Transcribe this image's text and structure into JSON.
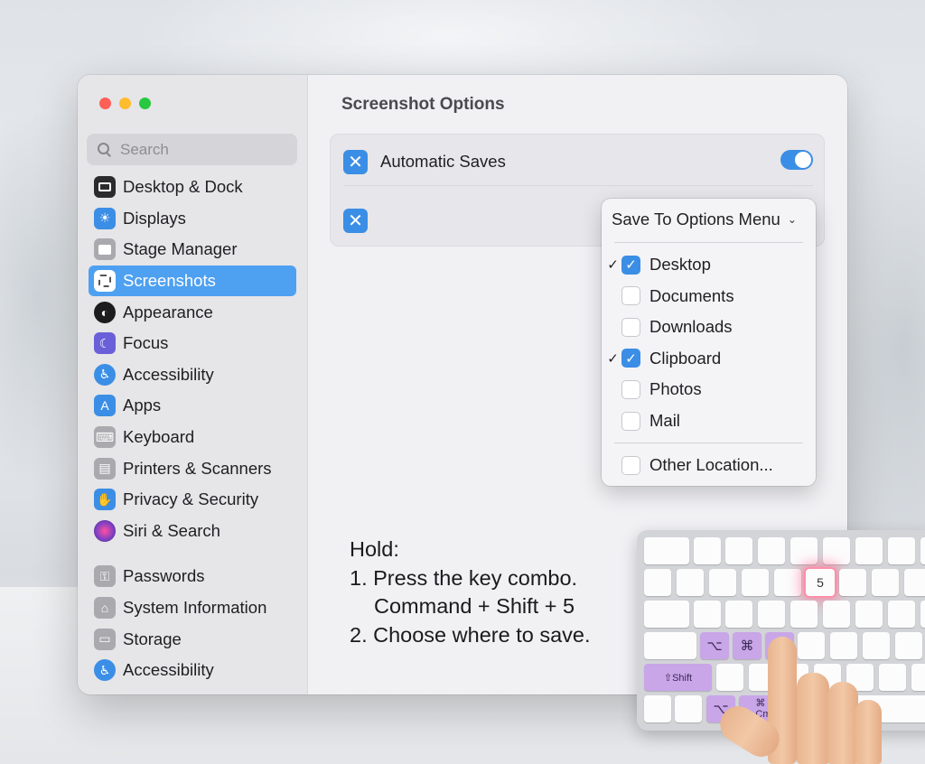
{
  "sidebar": {
    "search_placeholder": "Search",
    "items": [
      {
        "label": "Desktop & Dock",
        "icon": "desktop-dock-icon",
        "color": "#2b2b2e"
      },
      {
        "label": "Displays",
        "icon": "displays-icon",
        "color": "#3b8ee5"
      },
      {
        "label": "Stage Manager",
        "icon": "stage-manager-icon",
        "color": "#7a7a80"
      },
      {
        "label": "Screenshots",
        "icon": "screenshots-icon",
        "color": "#ffffff"
      },
      {
        "label": "Appearance",
        "icon": "appearance-icon",
        "color": "#1c1c1e"
      },
      {
        "label": "Focus",
        "icon": "focus-icon",
        "color": "#6a5fd8"
      },
      {
        "label": "Accessibility",
        "icon": "accessibility-icon",
        "color": "#3b8ee5"
      },
      {
        "label": "Apps",
        "icon": "apps-icon",
        "color": "#3b8ee5"
      },
      {
        "label": "Keyboard",
        "icon": "keyboard-icon",
        "color": "#8e8e93"
      },
      {
        "label": "Printers & Scanners",
        "icon": "printers-icon",
        "color": "#8e8e93"
      },
      {
        "label": "Privacy & Security",
        "icon": "privacy-hand-icon",
        "color": "#3b8ee5"
      },
      {
        "label": "Siri & Search",
        "icon": "siri-icon",
        "color": "#7b3fc4"
      },
      {
        "label": "Passwords",
        "icon": "passwords-key-icon",
        "color": "#8e8e93"
      },
      {
        "label": "System Information",
        "icon": "system-information-icon",
        "color": "#8e8e93"
      },
      {
        "label": "Storage",
        "icon": "storage-icon",
        "color": "#8e8e93"
      },
      {
        "label": "Accessibility",
        "icon": "accessibility-icon",
        "color": "#3b8ee5"
      }
    ],
    "selected": "Screenshots"
  },
  "main": {
    "title": "Screenshot Options",
    "automatic_saves_label": "Automatic Saves",
    "automatic_saves_on": true,
    "save_to_label": "Save To Options Menu",
    "menu_items": [
      {
        "label": "Desktop",
        "checked": true
      },
      {
        "label": "Documents",
        "checked": false
      },
      {
        "label": "Downloads",
        "checked": false
      },
      {
        "label": "Clipboard",
        "checked": true
      },
      {
        "label": "Photos",
        "checked": false
      },
      {
        "label": "Mail",
        "checked": false
      }
    ],
    "other_location_label": "Other Location...",
    "checkmark": "✓"
  },
  "instructions": {
    "line1": "Hold:",
    "line2": "1. Press the key combo.",
    "line3": "Command + Shift + 5",
    "line4": "2. Choose where to save."
  },
  "keyboard": {
    "key_5": "5",
    "option_symbol": "⌥",
    "command_symbol": "⌘",
    "shift_label": "⇧Shift",
    "cmd_label": "⌘\nCmd",
    "highlight_color": "#c9a6e8"
  },
  "colors": {
    "accent": "#3b8ee5",
    "selection": "#4ea0f1"
  }
}
